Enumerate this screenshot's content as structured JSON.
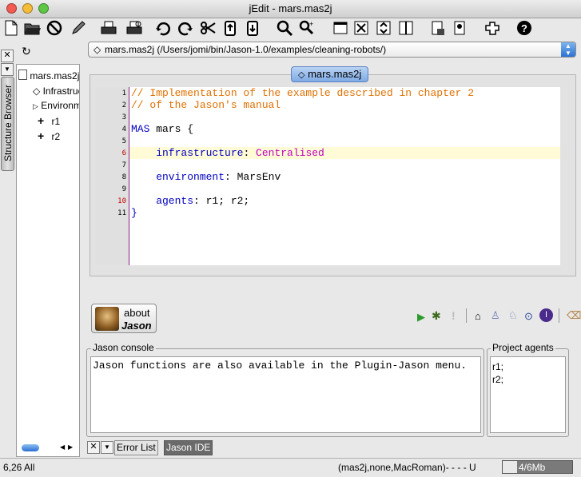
{
  "window": {
    "title": "jEdit - mars.mas2j"
  },
  "toolbar": {
    "icons": [
      "new-file-icon",
      "open-folder-icon",
      "close-icon",
      "pencil-icon",
      "print-icon",
      "print-preview-icon",
      "undo-icon",
      "redo-icon",
      "cut-icon",
      "copy-icon",
      "paste-icon",
      "search-icon",
      "search-next-icon",
      "new-view-icon",
      "split-icon",
      "unsplit-h-icon",
      "unsplit-v-icon",
      "buffer-options-icon",
      "global-options-icon",
      "plugin-icon",
      "help-icon"
    ]
  },
  "structure_browser": {
    "tab_label": "Structure Browser",
    "tree": [
      {
        "label": "mars.mas2j",
        "kind": "file"
      },
      {
        "label": "Infrastructure",
        "kind": "diamond"
      },
      {
        "label": "Environment",
        "kind": "triangle"
      },
      {
        "label": "r1",
        "kind": "plus"
      },
      {
        "label": "r2",
        "kind": "plus"
      }
    ]
  },
  "buffer_selector": {
    "value": "mars.mas2j (/Users/jomi/bin/Jason-1.0/examples/cleaning-robots/)"
  },
  "editor": {
    "tab_label": "mars.mas2j",
    "lines": [
      {
        "n": "1",
        "text": "// Implementation of the example described in chapter 2"
      },
      {
        "n": "2",
        "text": "// of the Jason's manual"
      },
      {
        "n": "3",
        "text": ""
      },
      {
        "n": "4",
        "kw": "MAS",
        "rest": " mars {"
      },
      {
        "n": "5",
        "text": ""
      },
      {
        "n": "6",
        "kw": "    infrastructure",
        "rest": ": ",
        "val": "Centralised"
      },
      {
        "n": "7",
        "text": ""
      },
      {
        "n": "8",
        "kw": "    environment",
        "rest": ": MarsEnv"
      },
      {
        "n": "9",
        "text": ""
      },
      {
        "n": "10",
        "kw": "    agents",
        "rest": ": r1; r2;"
      },
      {
        "n": "11",
        "kw": "}",
        "rest": ""
      }
    ]
  },
  "about": {
    "line1": "about",
    "line2": "Jason"
  },
  "console": {
    "title": "Jason console",
    "text": "Jason functions are also available in the Plugin-Jason menu."
  },
  "agents": {
    "title": "Project agents",
    "items": [
      "r1;",
      "r2;"
    ]
  },
  "bottom_tabs": {
    "error_list": "Error List",
    "jason_ide": "Jason IDE"
  },
  "statusbar": {
    "position": "6,26 All",
    "mode": "(mas2j,none,MacRoman)- - - - U",
    "memory": "4/6Mb"
  },
  "colors": {
    "comment": "#e07000",
    "keyword": "#0000c0",
    "value": "#c000c0",
    "gutter_border": "#8a1e8a",
    "highlight": "#fffbd6"
  }
}
